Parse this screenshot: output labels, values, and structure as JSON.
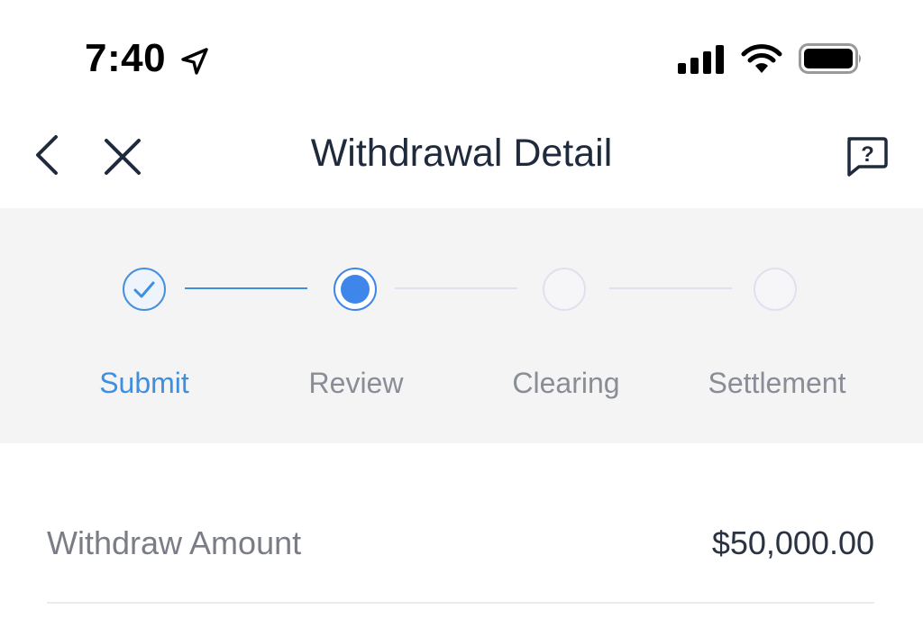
{
  "status_bar": {
    "time": "7:40",
    "icons": [
      "location-arrow-icon",
      "cellular-signal-icon",
      "wifi-icon",
      "battery-icon"
    ]
  },
  "nav": {
    "title": "Withdrawal Detail",
    "icons": [
      "back-chevron-icon",
      "close-icon",
      "help-question-icon"
    ]
  },
  "stepper": {
    "steps": [
      {
        "label": "Submit",
        "state": "done"
      },
      {
        "label": "Review",
        "state": "active"
      },
      {
        "label": "Clearing",
        "state": "pending"
      },
      {
        "label": "Settlement",
        "state": "pending"
      }
    ],
    "colors": {
      "done": "#3f8fe0",
      "active": "#3f86ea",
      "pending_border": "#e0e1ee",
      "pending_text": "#8a8d96",
      "panel_bg": "#f4f4f5"
    }
  },
  "details": {
    "rows": [
      {
        "label": "Withdraw Amount",
        "value": "$50,000.00"
      }
    ]
  }
}
